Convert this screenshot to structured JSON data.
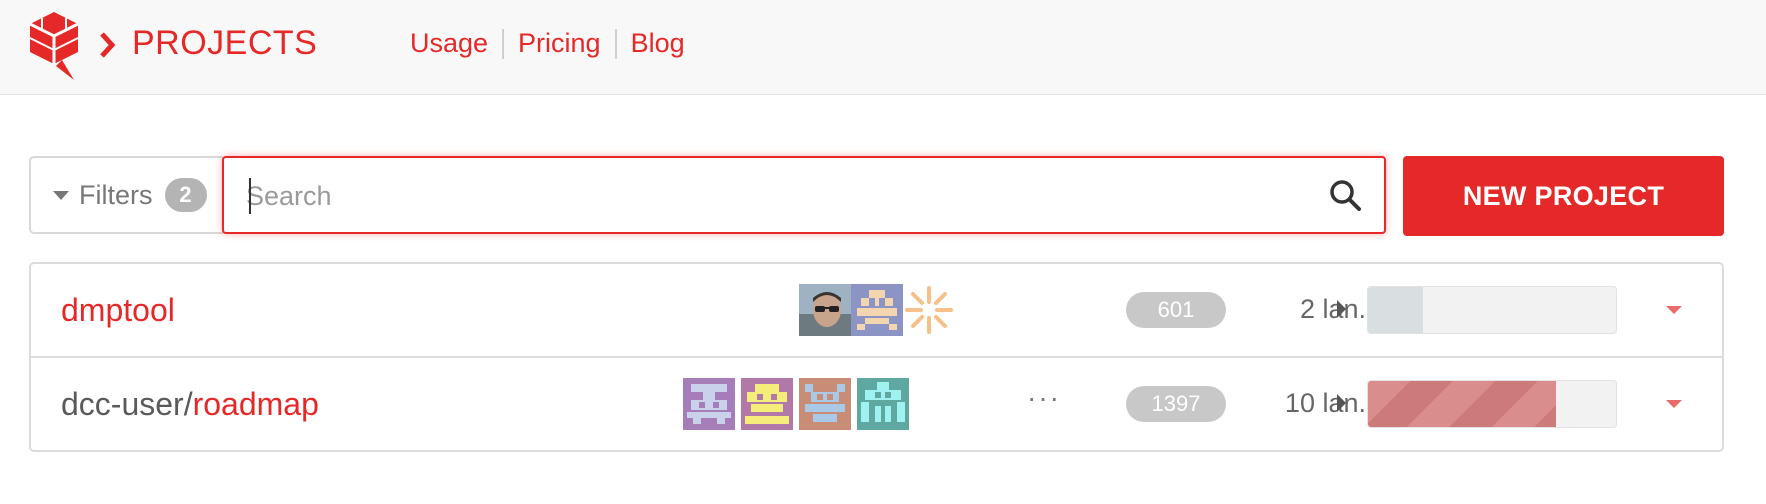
{
  "header": {
    "title": "PROJECTS",
    "nav": [
      {
        "label": "Usage"
      },
      {
        "label": "Pricing"
      },
      {
        "label": "Blog"
      }
    ]
  },
  "toolbar": {
    "filters_label": "Filters",
    "filters_count": "2",
    "search_placeholder": "Search",
    "search_value": "",
    "new_project_label": "NEW PROJECT"
  },
  "projects": [
    {
      "owner": "",
      "name": "dmptool",
      "count": "601",
      "languages": "2 lan.",
      "progress": 0.22,
      "avatars": [
        "photo-avatar",
        "identicon-avatar",
        "identicon-avatar"
      ],
      "more": ""
    },
    {
      "owner": "dcc-user/",
      "name": "roadmap",
      "count": "1397",
      "languages": "10 lan.",
      "progress": 0.76,
      "avatars": [
        "identicon-avatar",
        "identicon-avatar",
        "identicon-avatar",
        "identicon-avatar"
      ],
      "more": "···"
    }
  ],
  "colors": {
    "accent": "#e52828",
    "badge": "#c8c8c8"
  }
}
